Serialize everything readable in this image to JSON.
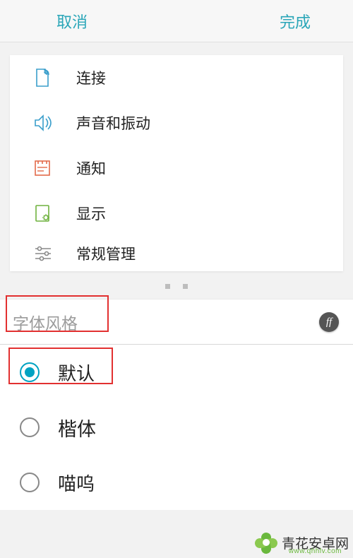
{
  "header": {
    "cancel": "取消",
    "done": "完成"
  },
  "settings": {
    "items": [
      {
        "label": "连接"
      },
      {
        "label": "声音和振动"
      },
      {
        "label": "通知"
      },
      {
        "label": "显示"
      },
      {
        "label": "常规管理"
      }
    ]
  },
  "fontStyle": {
    "title": "字体风格",
    "badge": "ff",
    "options": [
      {
        "label": "默认",
        "selected": true
      },
      {
        "label": "楷体",
        "selected": false
      },
      {
        "label": "喵呜",
        "selected": false
      }
    ]
  },
  "watermark": {
    "text": "青花安卓网",
    "url": "www.qhhlv.com"
  }
}
